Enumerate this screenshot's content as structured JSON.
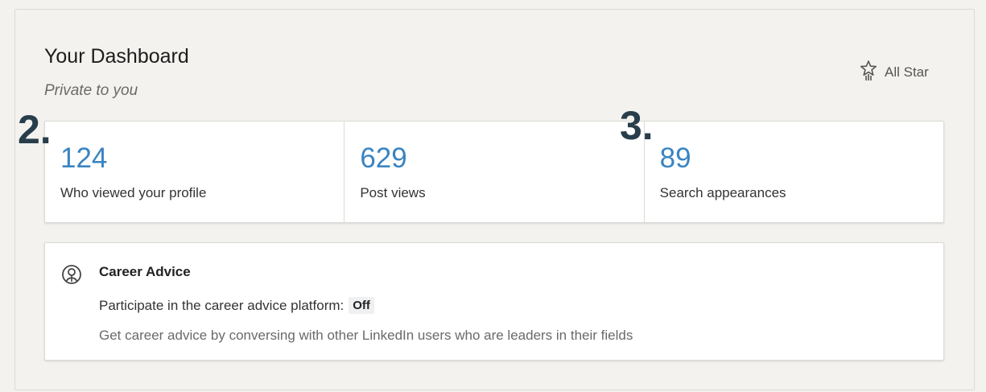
{
  "dashboard": {
    "title": "Your Dashboard",
    "subtitle": "Private to you",
    "badge_label": "All Star",
    "badge_icon": "all-star-icon"
  },
  "stats": [
    {
      "value": "124",
      "label": "Who viewed your profile"
    },
    {
      "value": "629",
      "label": "Post views"
    },
    {
      "value": "89",
      "label": "Search appearances"
    }
  ],
  "markers": {
    "first": "2.",
    "second": "3."
  },
  "career_advice": {
    "icon": "career-advice-icon",
    "title": "Career Advice",
    "setting_label": "Participate in the career advice platform:",
    "setting_value": "Off",
    "description": "Get career advice by conversing with other LinkedIn users who are leaders in their fields"
  },
  "colors": {
    "stat_value": "#3a84c2",
    "marker": "#283e4a"
  }
}
